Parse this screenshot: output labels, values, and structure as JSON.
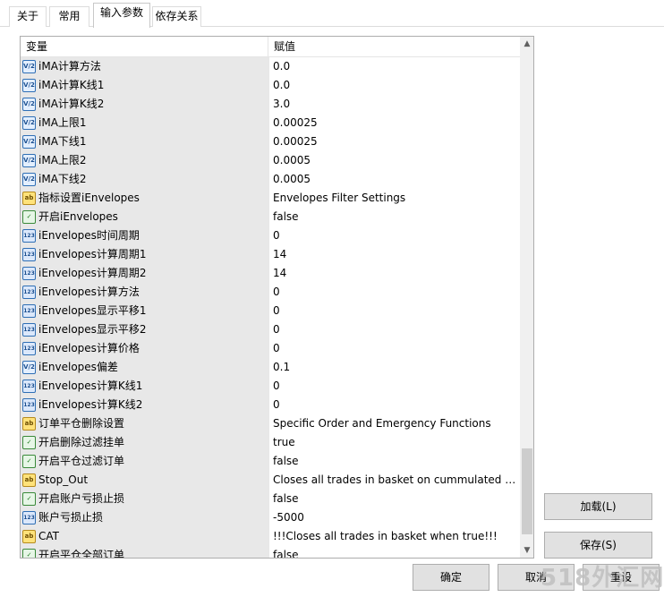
{
  "tabs": [
    {
      "label": "关于"
    },
    {
      "label": "常用"
    },
    {
      "label": "输入参数"
    },
    {
      "label": "依存关系"
    }
  ],
  "grid": {
    "header": {
      "variable": "变量",
      "value": "赋值"
    },
    "rows": [
      {
        "type": "dbl",
        "name": "iMA计算方法",
        "value": "0.0"
      },
      {
        "type": "dbl",
        "name": "iMA计算K线1",
        "value": "0.0"
      },
      {
        "type": "dbl",
        "name": "iMA计算K线2",
        "value": "3.0"
      },
      {
        "type": "dbl",
        "name": "iMA上限1",
        "value": "0.00025"
      },
      {
        "type": "dbl",
        "name": "iMA下线1",
        "value": "0.00025"
      },
      {
        "type": "dbl",
        "name": "iMA上限2",
        "value": "0.0005"
      },
      {
        "type": "dbl",
        "name": "iMA下线2",
        "value": "0.0005"
      },
      {
        "type": "str",
        "name": "指标设置iEnvelopes",
        "value": "Envelopes Filter Settings"
      },
      {
        "type": "bool",
        "name": "开启iEnvelopes",
        "value": "false"
      },
      {
        "type": "int",
        "name": "iEnvelopes时间周期",
        "value": "0"
      },
      {
        "type": "int",
        "name": "iEnvelopes计算周期1",
        "value": "14"
      },
      {
        "type": "int",
        "name": "iEnvelopes计算周期2",
        "value": "14"
      },
      {
        "type": "int",
        "name": "iEnvelopes计算方法",
        "value": "0"
      },
      {
        "type": "int",
        "name": "iEnvelopes显示平移1",
        "value": "0"
      },
      {
        "type": "int",
        "name": "iEnvelopes显示平移2",
        "value": "0"
      },
      {
        "type": "int",
        "name": "iEnvelopes计算价格",
        "value": "0"
      },
      {
        "type": "dbl",
        "name": "iEnvelopes偏差",
        "value": "0.1"
      },
      {
        "type": "int",
        "name": "iEnvelopes计算K线1",
        "value": "0"
      },
      {
        "type": "int",
        "name": "iEnvelopes计算K线2",
        "value": "0"
      },
      {
        "type": "str",
        "name": "订单平仓删除设置",
        "value": "Specific Order and Emergency Functions"
      },
      {
        "type": "bool",
        "name": "开启删除过滤挂单",
        "value": "true"
      },
      {
        "type": "bool",
        "name": "开启平仓过滤订单",
        "value": "false"
      },
      {
        "type": "str",
        "name": "Stop_Out",
        "value": "Closes all trades in basket on cummulated Pr..."
      },
      {
        "type": "bool",
        "name": "开启账户亏损止损",
        "value": "false"
      },
      {
        "type": "int",
        "name": "账户亏损止损",
        "value": "-5000"
      },
      {
        "type": "str",
        "name": "CAT",
        "value": "!!!Closes all trades in basket when true!!!"
      },
      {
        "type": "bool",
        "name": "开启平仓全部订单",
        "value": "false"
      }
    ]
  },
  "icon_labels": {
    "dbl": "V/2",
    "str": "ab",
    "bool": "✓",
    "int": "123"
  },
  "buttons": {
    "load": "加载(L)",
    "save": "保存(S)",
    "ok": "确定",
    "cancel": "取消",
    "reset": "重设"
  },
  "watermark": "518外汇网"
}
